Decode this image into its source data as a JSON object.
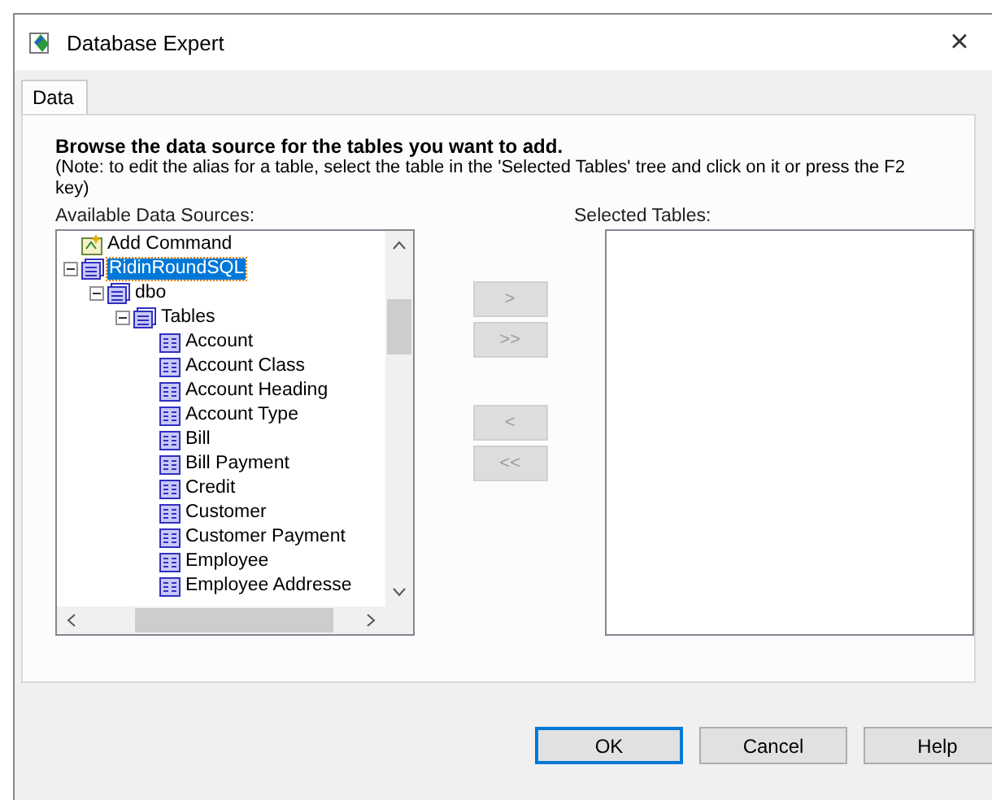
{
  "window": {
    "title": "Database Expert",
    "close": "×"
  },
  "tabs": [
    {
      "label": "Data",
      "selected": true
    }
  ],
  "heading": "Browse the data source for the tables you want to add.",
  "note": "(Note: to edit the alias for a table, select the table in the 'Selected Tables' tree and click on it or press the F2 key)",
  "available_label": "Available Data Sources:",
  "selected_label": "Selected Tables:",
  "tree": [
    {
      "label": "Add Command",
      "kind": "command",
      "selected": false
    },
    {
      "label": "RidinRoundSQL",
      "kind": "database",
      "expanded": true,
      "selected": true,
      "children": [
        {
          "label": "dbo",
          "kind": "database",
          "expanded": true,
          "selected": false,
          "children": [
            {
              "label": "Tables",
              "kind": "database",
              "expanded": true,
              "selected": false,
              "children": [
                {
                  "label": "Account",
                  "kind": "table",
                  "selected": false
                },
                {
                  "label": "Account Class",
                  "kind": "table",
                  "selected": false
                },
                {
                  "label": "Account Heading",
                  "kind": "table",
                  "selected": false
                },
                {
                  "label": "Account Type",
                  "kind": "table",
                  "selected": false
                },
                {
                  "label": "Bill",
                  "kind": "table",
                  "selected": false
                },
                {
                  "label": "Bill Payment",
                  "kind": "table",
                  "selected": false
                },
                {
                  "label": "Credit",
                  "kind": "table",
                  "selected": false
                },
                {
                  "label": "Customer",
                  "kind": "table",
                  "selected": false
                },
                {
                  "label": "Customer Payment",
                  "kind": "table",
                  "selected": false
                },
                {
                  "label": "Employee",
                  "kind": "table",
                  "selected": false
                },
                {
                  "label": "Employee Addresse",
                  "kind": "table",
                  "selected": false
                }
              ]
            }
          ]
        }
      ]
    }
  ],
  "move_buttons": [
    {
      "label": ">",
      "disabled": true
    },
    {
      "label": ">>",
      "disabled": true
    },
    {
      "label": "<",
      "disabled": true
    },
    {
      "label": "<<",
      "disabled": true
    }
  ],
  "buttons": [
    {
      "label": "OK",
      "default": true
    },
    {
      "label": "Cancel",
      "default": false
    },
    {
      "label": "Help",
      "default": false
    }
  ]
}
